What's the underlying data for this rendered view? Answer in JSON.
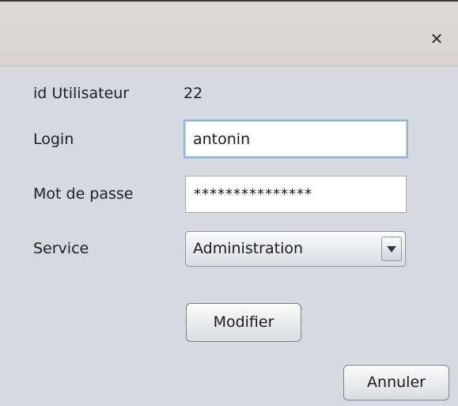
{
  "titlebar": {
    "close_symbol": "✕",
    "close_icon": "close-icon"
  },
  "form": {
    "id_label": "id Utilisateur",
    "id_value": "22",
    "login_label": "Login",
    "login_value": "antonin",
    "password_label": "Mot de passe",
    "password_value": "***************",
    "service_label": "Service",
    "service_selected": "Administration",
    "service_dropdown_icon": "chevron-down-icon"
  },
  "buttons": {
    "modify_label": "Modifier",
    "cancel_label": "Annuler"
  },
  "colors": {
    "window_bg": "#d6d9df",
    "titlebar_bg": "#dbd8d2",
    "focus_border": "#8fb3d6",
    "dropdown_arrow": "#2a3a4e"
  }
}
